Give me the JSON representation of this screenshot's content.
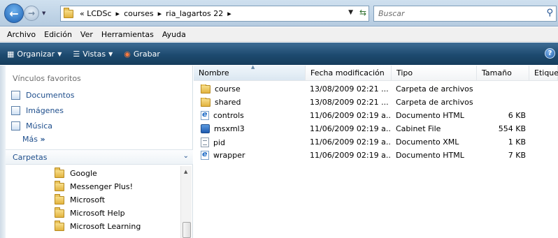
{
  "address": {
    "crumbs": [
      "« LCDSc",
      "courses",
      "ria_lagartos 22"
    ],
    "search_placeholder": "Buscar"
  },
  "menu": [
    "Archivo",
    "Edición",
    "Ver",
    "Herramientas",
    "Ayuda"
  ],
  "commands": {
    "organize": "Organizar",
    "views": "Vistas",
    "burn": "Grabar",
    "help": "?"
  },
  "nav": {
    "favorites_title": "Vínculos favoritos",
    "favorites": [
      "Documentos",
      "Imágenes",
      "Música"
    ],
    "more": "Más",
    "more_glyph": "»",
    "folders_title": "Carpetas",
    "tree": [
      "Google",
      "Messenger Plus!",
      "Microsoft",
      "Microsoft Help",
      "Microsoft Learning"
    ]
  },
  "columns": {
    "name": "Nombre",
    "date": "Fecha modificación",
    "type": "Tipo",
    "size": "Tamaño",
    "tags": "Etique"
  },
  "files": [
    {
      "name": "course",
      "date": "13/08/2009 02:21 ...",
      "type": "Carpeta de archivos",
      "size": "",
      "icon": "folder-icon"
    },
    {
      "name": "shared",
      "date": "13/08/2009 02:21 ...",
      "type": "Carpeta de archivos",
      "size": "",
      "icon": "folder-icon"
    },
    {
      "name": "controls",
      "date": "11/06/2009 02:19 a...",
      "type": "Documento HTML",
      "size": "6 KB",
      "icon": "html-file-icon"
    },
    {
      "name": "msxml3",
      "date": "11/06/2009 02:19 a...",
      "type": "Cabinet File",
      "size": "554 KB",
      "icon": "cabinet-file-icon"
    },
    {
      "name": "pid",
      "date": "11/06/2009 02:19 a...",
      "type": "Documento XML",
      "size": "1 KB",
      "icon": "xml-file-icon"
    },
    {
      "name": "wrapper",
      "date": "11/06/2009 02:19 a...",
      "type": "Documento HTML",
      "size": "7 KB",
      "icon": "html-file-icon"
    }
  ]
}
